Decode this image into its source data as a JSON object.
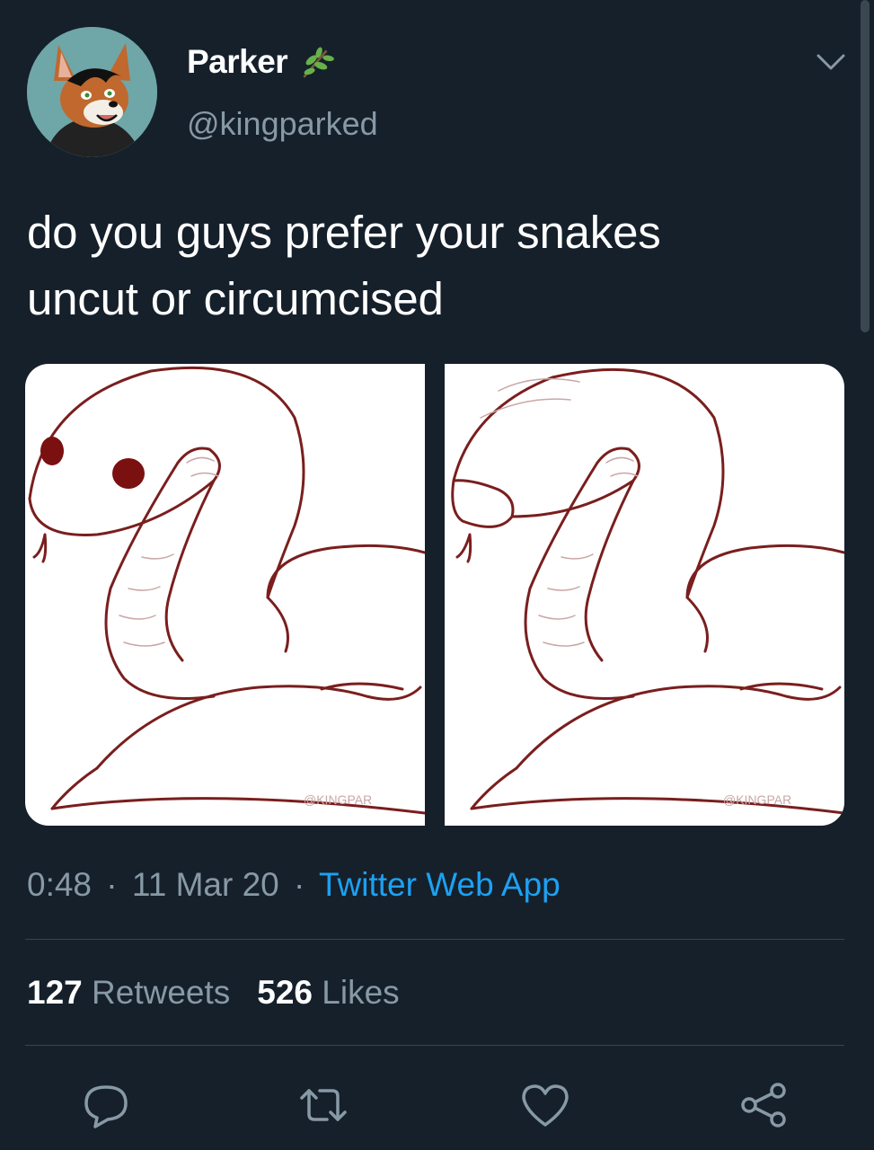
{
  "user": {
    "display_name": "Parker",
    "handle": "@kingparked"
  },
  "tweet": {
    "text_line1": "do you guys prefer your snakes",
    "text_line2": "uncut or circumcised"
  },
  "media": {
    "left": {
      "watermark": "@KINGPAR"
    },
    "right": {
      "watermark": "@KINGPAR"
    }
  },
  "meta": {
    "time": "0:48",
    "date": "11 Mar 20",
    "separator": "·",
    "source": "Twitter Web App"
  },
  "stats": {
    "retweets_count": "127",
    "retweets_label": "Retweets",
    "likes_count": "526",
    "likes_label": "Likes"
  },
  "icons": {
    "verified_emoji": "leaf-icon",
    "menu": "chevron-down-icon",
    "reply": "reply-icon",
    "retweet": "retweet-icon",
    "like": "heart-icon",
    "share": "share-icon"
  },
  "colors": {
    "background": "#15202b",
    "primary_text": "#ffffff",
    "secondary_text": "#8899a6",
    "link": "#1da1f2",
    "divider": "#38444d",
    "sketch_line": "#7a1e1e"
  }
}
